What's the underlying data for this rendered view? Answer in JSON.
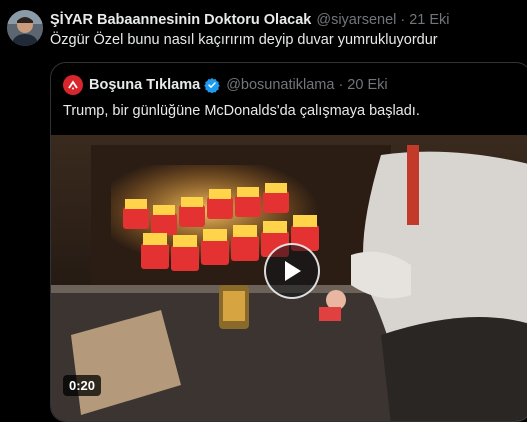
{
  "tweet": {
    "display_name": "ŞİYAR Babaannesinin Doktoru Olacak",
    "handle": "@siyarsenel",
    "separator": "·",
    "date": "21 Eki",
    "text": "Özgür Özel bunu nasıl kaçırırım deyip duvar yumrukluyordur"
  },
  "quote": {
    "display_name": "Boşuna Tıklama",
    "verified_icon": "verified-badge-icon",
    "handle": "@bosunatiklama",
    "separator": "·",
    "date": "20 Eki",
    "text": "Trump, bir günlüğüne McDonalds'da çalışmaya başladı.",
    "media": {
      "duration": "0:20",
      "play_icon": "play-icon"
    }
  },
  "colors": {
    "background": "#000000",
    "text": "#e7e9ea",
    "muted": "#71767b",
    "border": "#2f3336",
    "verified": "#1d9bf0",
    "quote_avatar": "#d7262c"
  }
}
